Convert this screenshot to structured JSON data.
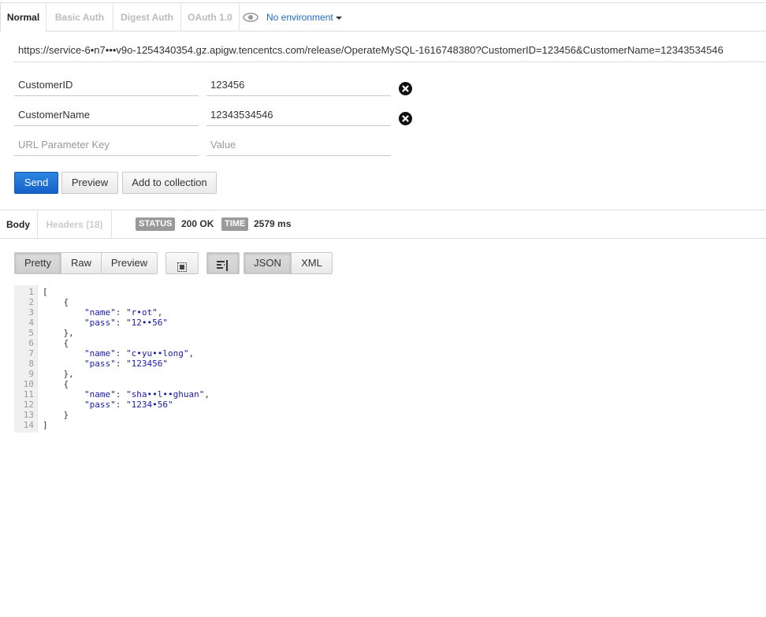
{
  "auth_tabs": [
    {
      "label": "Normal",
      "active": true
    },
    {
      "label": "Basic Auth",
      "active": false
    },
    {
      "label": "Digest Auth",
      "active": false
    },
    {
      "label": "OAuth 1.0",
      "active": false
    }
  ],
  "environment": {
    "label": "No environment",
    "icon": "eye-icon"
  },
  "request": {
    "url": "https://service-6•n7•••v9o-1254340354.gz.apigw.tencentcs.com/release/OperateMySQL-1616748380?CustomerID=123456&CustomerName=12343534546"
  },
  "params": [
    {
      "key": "CustomerID",
      "value": "123456"
    },
    {
      "key": "CustomerName",
      "value": "12343534546"
    }
  ],
  "param_placeholders": {
    "key": "URL Parameter Key",
    "value": "Value"
  },
  "actions": {
    "send": "Send",
    "preview": "Preview",
    "add_to_collection": "Add to collection"
  },
  "response": {
    "tabs": [
      {
        "label": "Body",
        "active": true
      },
      {
        "label": "Headers (18)",
        "active": false
      }
    ],
    "status_label": "STATUS",
    "status_value": "200 OK",
    "time_label": "TIME",
    "time_value": "2579 ms",
    "view_modes": [
      "Pretty",
      "Raw",
      "Preview"
    ],
    "active_view": "Pretty",
    "formats": [
      "JSON",
      "XML"
    ],
    "active_format": "JSON",
    "code_lines": [
      "[",
      "    {",
      "        \"name\": \"r•ot\",",
      "        \"pass\": \"12••56\"",
      "    },",
      "    {",
      "        \"name\": \"c•yu••long\",",
      "        \"pass\": \"123456\"",
      "    },",
      "    {",
      "        \"name\": \"sha••l••ghuan\",",
      "        \"pass\": \"1234•56\"",
      "    }",
      "]"
    ]
  },
  "colors": {
    "accent": "#1b6ac9",
    "send": "#1761c9",
    "label_bg": "#9a9a9a"
  }
}
